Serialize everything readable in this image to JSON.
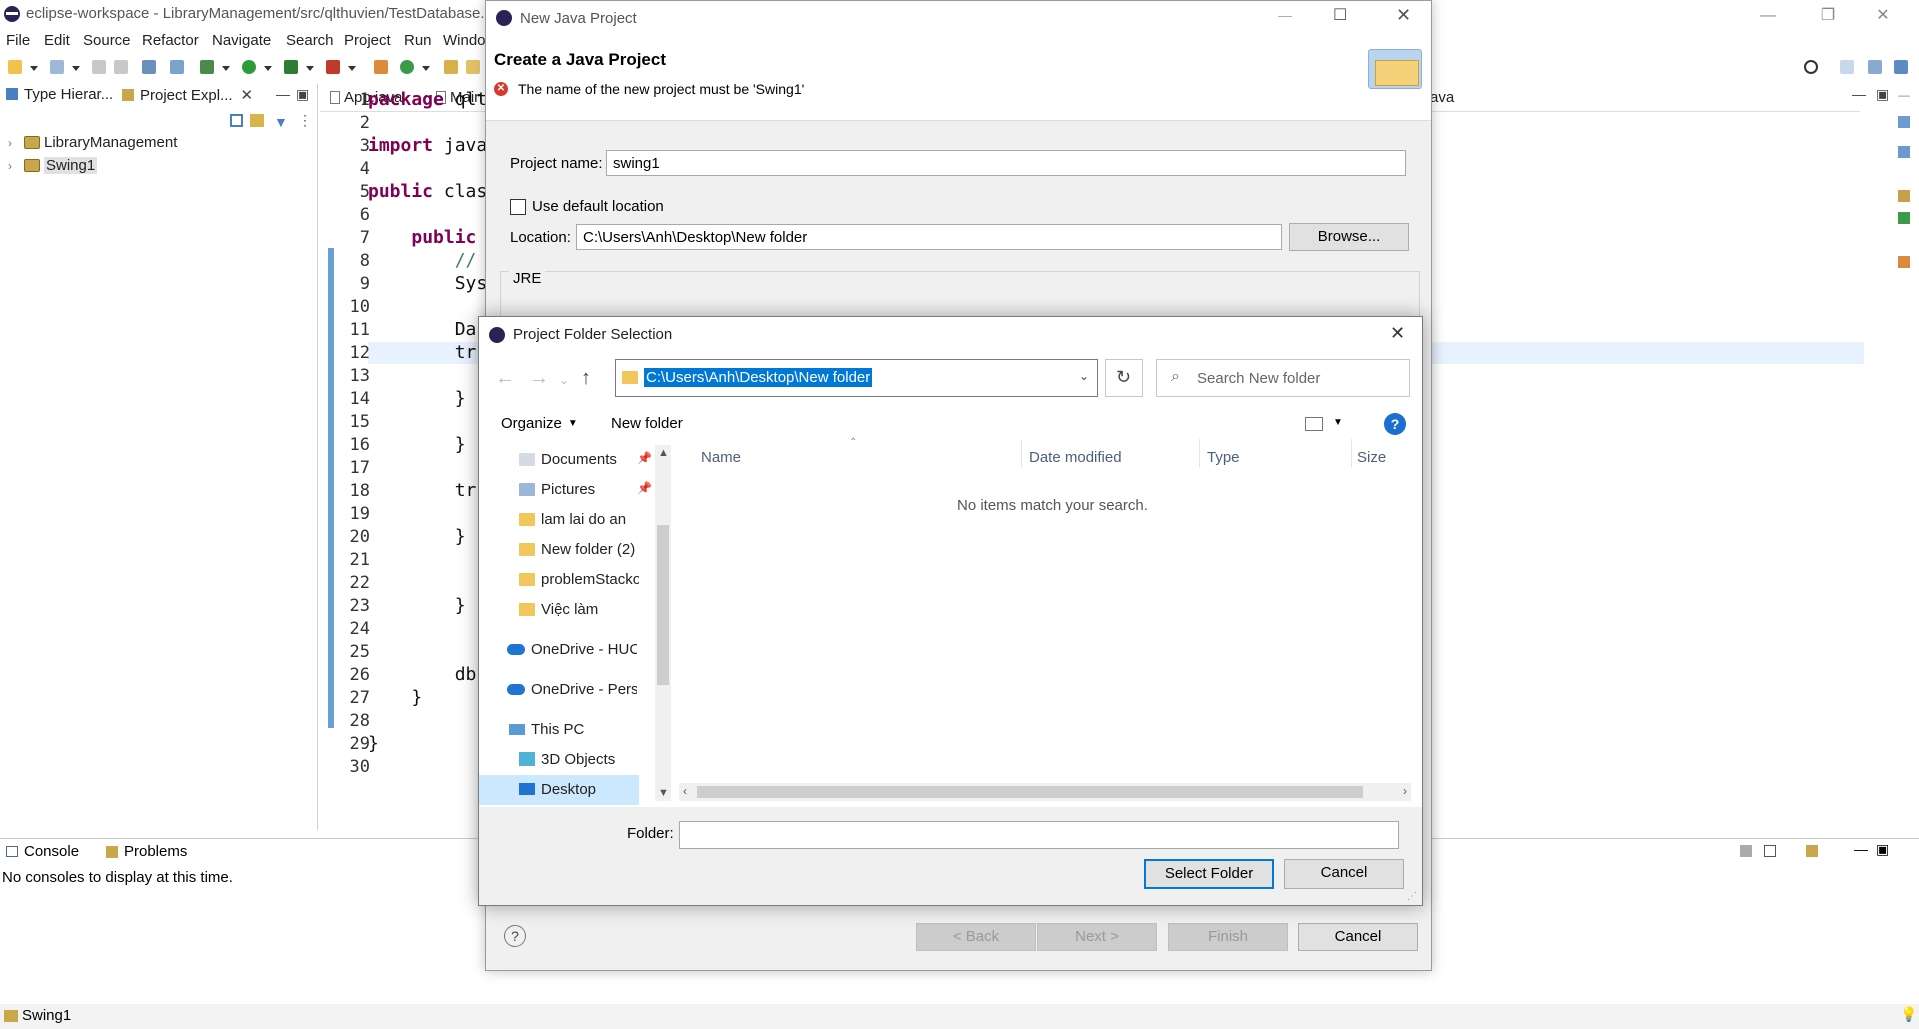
{
  "eclipse": {
    "window_title": "eclipse-workspace - LibraryManagement/src/qlthuvien/TestDatabase.",
    "menu": [
      "File",
      "Edit",
      "Source",
      "Refactor",
      "Navigate",
      "Search",
      "Project",
      "Run",
      "Windo"
    ],
    "explorer": {
      "tab_type_hierarchy": "Type Hierar...",
      "tab_project_explorer": "Project Expl...",
      "projects": [
        "LibraryManagement",
        "Swing1"
      ]
    },
    "editor": {
      "tabs": [
        "App.java",
        "Main",
        "ava"
      ],
      "line_numbers": [
        "1",
        "2",
        "3",
        "4",
        "5",
        "6",
        "7",
        "8",
        "9",
        "10",
        "11",
        "12",
        "13",
        "14",
        "15",
        "16",
        "17",
        "18",
        "19",
        "20",
        "21",
        "22",
        "23",
        "24",
        "25",
        "26",
        "27",
        "28",
        "29",
        "30"
      ],
      "lines": [
        "package qlt",
        "",
        "import java",
        "",
        "public clas",
        "",
        "    public",
        "        //",
        "        Sys",
        "",
        "        Da",
        "        tr",
        "",
        "        }",
        "",
        "        }",
        "",
        "        tr",
        "",
        "        }",
        "",
        "",
        "        }",
        "",
        "",
        "        db",
        "    }",
        "",
        "}",
        ""
      ]
    },
    "console": {
      "tab_console": "Console",
      "tab_problems": "Problems",
      "message": "No consoles to display at this time."
    },
    "status": "Swing1"
  },
  "new_java_project": {
    "title": "New Java Project",
    "heading": "Create a Java Project",
    "error": "The name of the new project must be 'Swing1'",
    "project_name_label": "Project name:",
    "project_name_value": "swing1",
    "use_default_location_label": "Use default location",
    "use_default_location_checked": false,
    "location_label": "Location:",
    "location_value": "C:\\Users\\Anh\\Desktop\\New folder",
    "browse_label": "Browse...",
    "jre_label": "JRE",
    "buttons": {
      "help": "?",
      "back": "< Back",
      "next": "Next >",
      "finish": "Finish",
      "cancel": "Cancel"
    }
  },
  "folder_selection": {
    "title": "Project Folder Selection",
    "address": "C:\\Users\\Anh\\Desktop\\New folder",
    "search_placeholder": "Search New folder",
    "organize_label": "Organize",
    "new_folder_label": "New folder",
    "nav_items": [
      {
        "label": "Documents",
        "icon": "documents-icon",
        "pinned": true
      },
      {
        "label": "Pictures",
        "icon": "pictures-icon",
        "pinned": true
      },
      {
        "label": "lam lai do an",
        "icon": "folder-icon"
      },
      {
        "label": "New folder (2)",
        "icon": "folder-icon"
      },
      {
        "label": "problemStackov",
        "icon": "folder-icon"
      },
      {
        "label": "Việc làm",
        "icon": "folder-icon"
      },
      {
        "label": "OneDrive - HUCE",
        "icon": "onedrive-icon"
      },
      {
        "label": "OneDrive - Person",
        "icon": "onedrive-icon"
      },
      {
        "label": "This PC",
        "icon": "pc-icon"
      },
      {
        "label": "3D Objects",
        "icon": "3d-objects-icon"
      },
      {
        "label": "Desktop",
        "icon": "desktop-icon",
        "selected": true
      }
    ],
    "columns": [
      "Name",
      "Date modified",
      "Type",
      "Size"
    ],
    "empty_message": "No items match your search.",
    "folder_label": "Folder:",
    "folder_value": "",
    "select_folder_label": "Select Folder",
    "cancel_label": "Cancel"
  },
  "colors": {
    "selection_blue": "#0078d7",
    "keyword": "#7f0055",
    "comment": "#3f7f5f",
    "error_red": "#d43b2e"
  }
}
